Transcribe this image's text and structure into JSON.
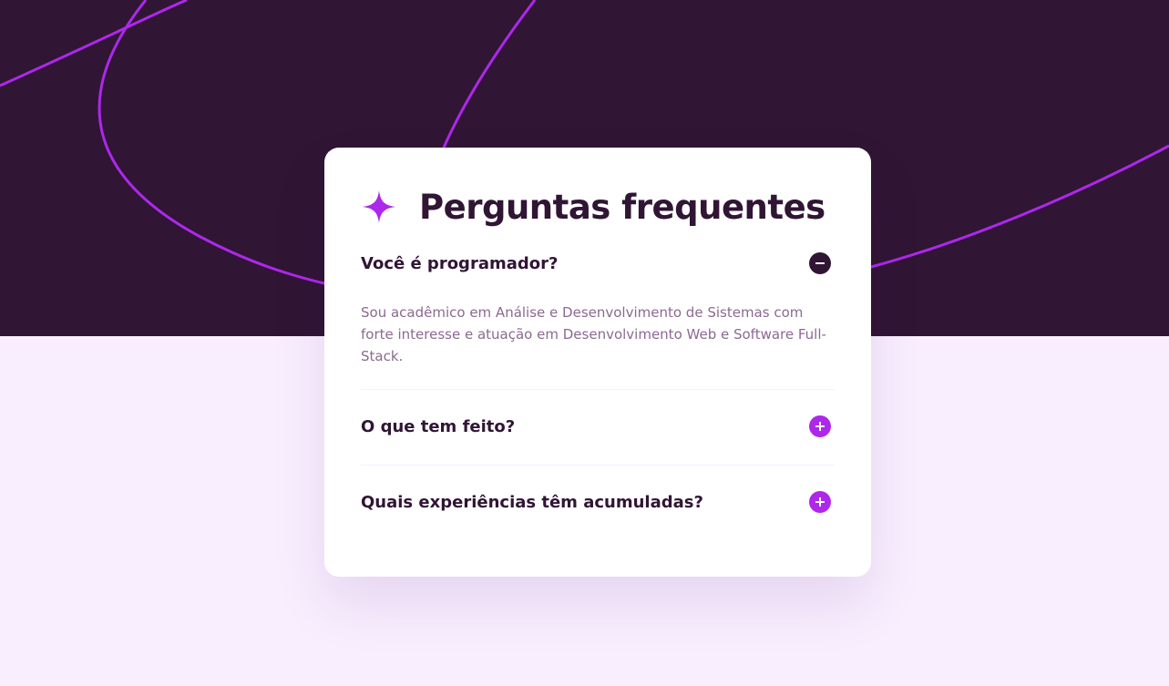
{
  "colors": {
    "dark_purple": "#301534",
    "accent_purple": "#ad28eb",
    "light_background": "#f8eefe",
    "card_background": "#ffffff",
    "answer_text": "#8c6991"
  },
  "header": {
    "icon": "star-icon",
    "title": "Perguntas frequentes"
  },
  "faq": [
    {
      "question": "Você é programador?",
      "expanded": true,
      "toggle_icon": "minus-icon",
      "answer": "Sou acadêmico em Análise e Desenvolvimento de Sistemas com forte interesse e atuação em Desenvolvimento Web e Software Full-Stack."
    },
    {
      "question": "O que tem feito?",
      "expanded": false,
      "toggle_icon": "plus-icon"
    },
    {
      "question": "Quais experiências têm acumuladas?",
      "expanded": false,
      "toggle_icon": "plus-icon"
    }
  ]
}
